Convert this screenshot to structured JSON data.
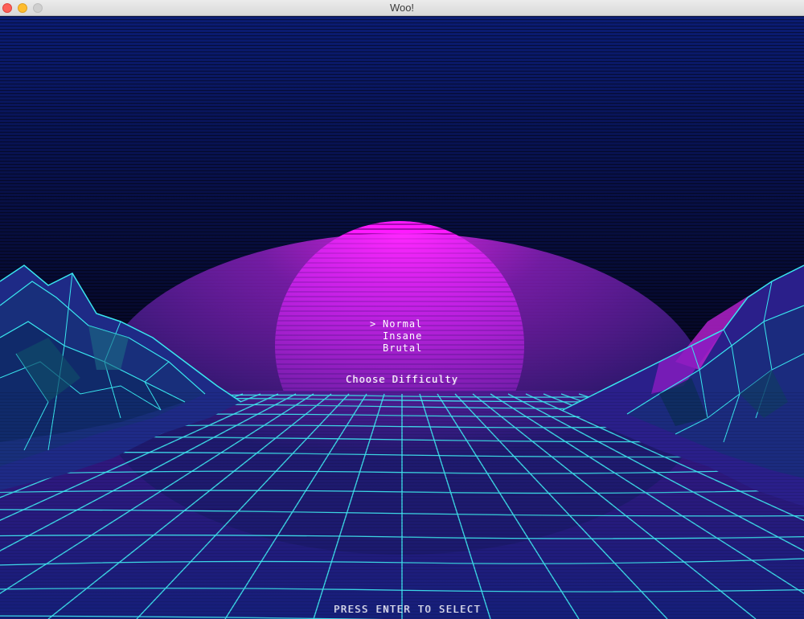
{
  "window": {
    "title": "Woo!"
  },
  "menu": {
    "cursor": ">",
    "items": [
      {
        "label": "Normal",
        "selected": true
      },
      {
        "label": "Insane",
        "selected": false
      },
      {
        "label": "Brutal",
        "selected": false
      }
    ],
    "heading": "Choose Difficulty"
  },
  "footer": {
    "hint": "PRESS ENTER TO SELECT"
  },
  "colors": {
    "sky_top": "#0a1a6e",
    "sky_bottom": "#06061f",
    "sun": "#ff19ff",
    "grid_line": "#3fe9f2",
    "grid_fill": "#3a1c8c"
  }
}
